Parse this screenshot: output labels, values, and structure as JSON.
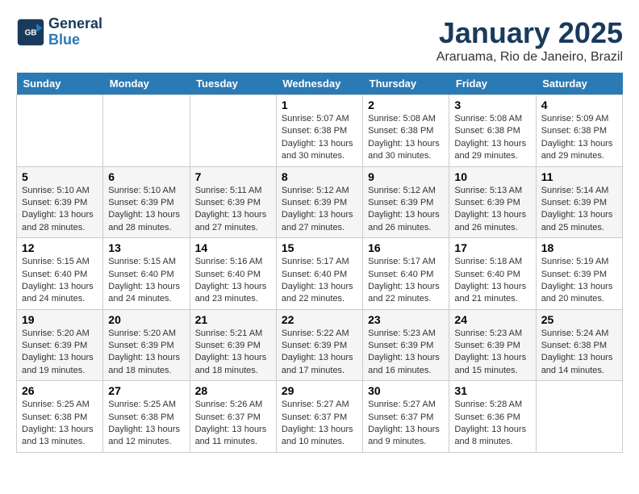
{
  "header": {
    "logo_line1": "General",
    "logo_line2": "Blue",
    "month_title": "January 2025",
    "location": "Araruama, Rio de Janeiro, Brazil"
  },
  "weekdays": [
    "Sunday",
    "Monday",
    "Tuesday",
    "Wednesday",
    "Thursday",
    "Friday",
    "Saturday"
  ],
  "weeks": [
    [
      {
        "day": "",
        "info": ""
      },
      {
        "day": "",
        "info": ""
      },
      {
        "day": "",
        "info": ""
      },
      {
        "day": "1",
        "info": "Sunrise: 5:07 AM\nSunset: 6:38 PM\nDaylight: 13 hours and 30 minutes."
      },
      {
        "day": "2",
        "info": "Sunrise: 5:08 AM\nSunset: 6:38 PM\nDaylight: 13 hours and 30 minutes."
      },
      {
        "day": "3",
        "info": "Sunrise: 5:08 AM\nSunset: 6:38 PM\nDaylight: 13 hours and 29 minutes."
      },
      {
        "day": "4",
        "info": "Sunrise: 5:09 AM\nSunset: 6:38 PM\nDaylight: 13 hours and 29 minutes."
      }
    ],
    [
      {
        "day": "5",
        "info": "Sunrise: 5:10 AM\nSunset: 6:39 PM\nDaylight: 13 hours and 28 minutes."
      },
      {
        "day": "6",
        "info": "Sunrise: 5:10 AM\nSunset: 6:39 PM\nDaylight: 13 hours and 28 minutes."
      },
      {
        "day": "7",
        "info": "Sunrise: 5:11 AM\nSunset: 6:39 PM\nDaylight: 13 hours and 27 minutes."
      },
      {
        "day": "8",
        "info": "Sunrise: 5:12 AM\nSunset: 6:39 PM\nDaylight: 13 hours and 27 minutes."
      },
      {
        "day": "9",
        "info": "Sunrise: 5:12 AM\nSunset: 6:39 PM\nDaylight: 13 hours and 26 minutes."
      },
      {
        "day": "10",
        "info": "Sunrise: 5:13 AM\nSunset: 6:39 PM\nDaylight: 13 hours and 26 minutes."
      },
      {
        "day": "11",
        "info": "Sunrise: 5:14 AM\nSunset: 6:39 PM\nDaylight: 13 hours and 25 minutes."
      }
    ],
    [
      {
        "day": "12",
        "info": "Sunrise: 5:15 AM\nSunset: 6:40 PM\nDaylight: 13 hours and 24 minutes."
      },
      {
        "day": "13",
        "info": "Sunrise: 5:15 AM\nSunset: 6:40 PM\nDaylight: 13 hours and 24 minutes."
      },
      {
        "day": "14",
        "info": "Sunrise: 5:16 AM\nSunset: 6:40 PM\nDaylight: 13 hours and 23 minutes."
      },
      {
        "day": "15",
        "info": "Sunrise: 5:17 AM\nSunset: 6:40 PM\nDaylight: 13 hours and 22 minutes."
      },
      {
        "day": "16",
        "info": "Sunrise: 5:17 AM\nSunset: 6:40 PM\nDaylight: 13 hours and 22 minutes."
      },
      {
        "day": "17",
        "info": "Sunrise: 5:18 AM\nSunset: 6:40 PM\nDaylight: 13 hours and 21 minutes."
      },
      {
        "day": "18",
        "info": "Sunrise: 5:19 AM\nSunset: 6:39 PM\nDaylight: 13 hours and 20 minutes."
      }
    ],
    [
      {
        "day": "19",
        "info": "Sunrise: 5:20 AM\nSunset: 6:39 PM\nDaylight: 13 hours and 19 minutes."
      },
      {
        "day": "20",
        "info": "Sunrise: 5:20 AM\nSunset: 6:39 PM\nDaylight: 13 hours and 18 minutes."
      },
      {
        "day": "21",
        "info": "Sunrise: 5:21 AM\nSunset: 6:39 PM\nDaylight: 13 hours and 18 minutes."
      },
      {
        "day": "22",
        "info": "Sunrise: 5:22 AM\nSunset: 6:39 PM\nDaylight: 13 hours and 17 minutes."
      },
      {
        "day": "23",
        "info": "Sunrise: 5:23 AM\nSunset: 6:39 PM\nDaylight: 13 hours and 16 minutes."
      },
      {
        "day": "24",
        "info": "Sunrise: 5:23 AM\nSunset: 6:39 PM\nDaylight: 13 hours and 15 minutes."
      },
      {
        "day": "25",
        "info": "Sunrise: 5:24 AM\nSunset: 6:38 PM\nDaylight: 13 hours and 14 minutes."
      }
    ],
    [
      {
        "day": "26",
        "info": "Sunrise: 5:25 AM\nSunset: 6:38 PM\nDaylight: 13 hours and 13 minutes."
      },
      {
        "day": "27",
        "info": "Sunrise: 5:25 AM\nSunset: 6:38 PM\nDaylight: 13 hours and 12 minutes."
      },
      {
        "day": "28",
        "info": "Sunrise: 5:26 AM\nSunset: 6:37 PM\nDaylight: 13 hours and 11 minutes."
      },
      {
        "day": "29",
        "info": "Sunrise: 5:27 AM\nSunset: 6:37 PM\nDaylight: 13 hours and 10 minutes."
      },
      {
        "day": "30",
        "info": "Sunrise: 5:27 AM\nSunset: 6:37 PM\nDaylight: 13 hours and 9 minutes."
      },
      {
        "day": "31",
        "info": "Sunrise: 5:28 AM\nSunset: 6:36 PM\nDaylight: 13 hours and 8 minutes."
      },
      {
        "day": "",
        "info": ""
      }
    ]
  ]
}
